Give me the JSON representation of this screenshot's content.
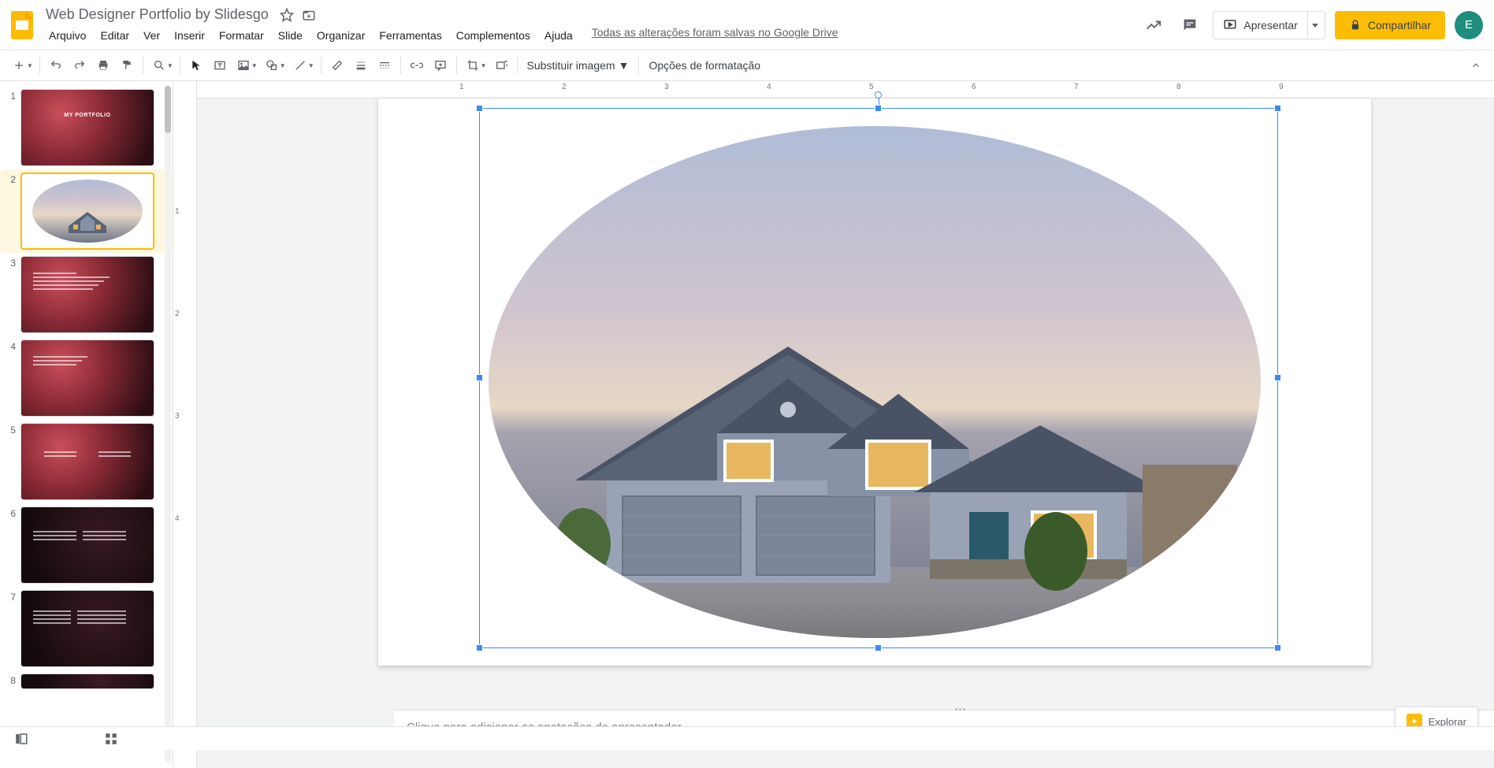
{
  "doc_title": "Web Designer Portfolio by Slidesgo",
  "save_status": "Todas as alterações foram salvas no Google Drive",
  "menu": {
    "file": "Arquivo",
    "edit": "Editar",
    "view": "Ver",
    "insert": "Inserir",
    "format": "Formatar",
    "slide": "Slide",
    "arrange": "Organizar",
    "tools": "Ferramentas",
    "addons": "Complementos",
    "help": "Ajuda"
  },
  "toolbar": {
    "replace_image": "Substituir imagem",
    "format_options": "Opções de formatação"
  },
  "header_buttons": {
    "present": "Apresentar",
    "share": "Compartilhar"
  },
  "avatar_initial": "E",
  "notes_placeholder": "Clique para adicionar as anotações do apresentador",
  "explore_label": "Explorar",
  "thumbnails": [
    {
      "num": "1",
      "kind": "smoke",
      "title": "MY PORTFOLIO"
    },
    {
      "num": "2",
      "kind": "house",
      "selected": true
    },
    {
      "num": "3",
      "kind": "smoke-text"
    },
    {
      "num": "4",
      "kind": "smoke-text"
    },
    {
      "num": "5",
      "kind": "smoke-text"
    },
    {
      "num": "6",
      "kind": "dark"
    },
    {
      "num": "7",
      "kind": "dark"
    },
    {
      "num": "8",
      "kind": "dark-partial"
    }
  ],
  "ruler": {
    "h_ticks": [
      "1",
      "2",
      "3",
      "4",
      "5",
      "6",
      "7",
      "8",
      "9"
    ],
    "v_ticks": [
      "1",
      "2",
      "3",
      "4"
    ]
  }
}
